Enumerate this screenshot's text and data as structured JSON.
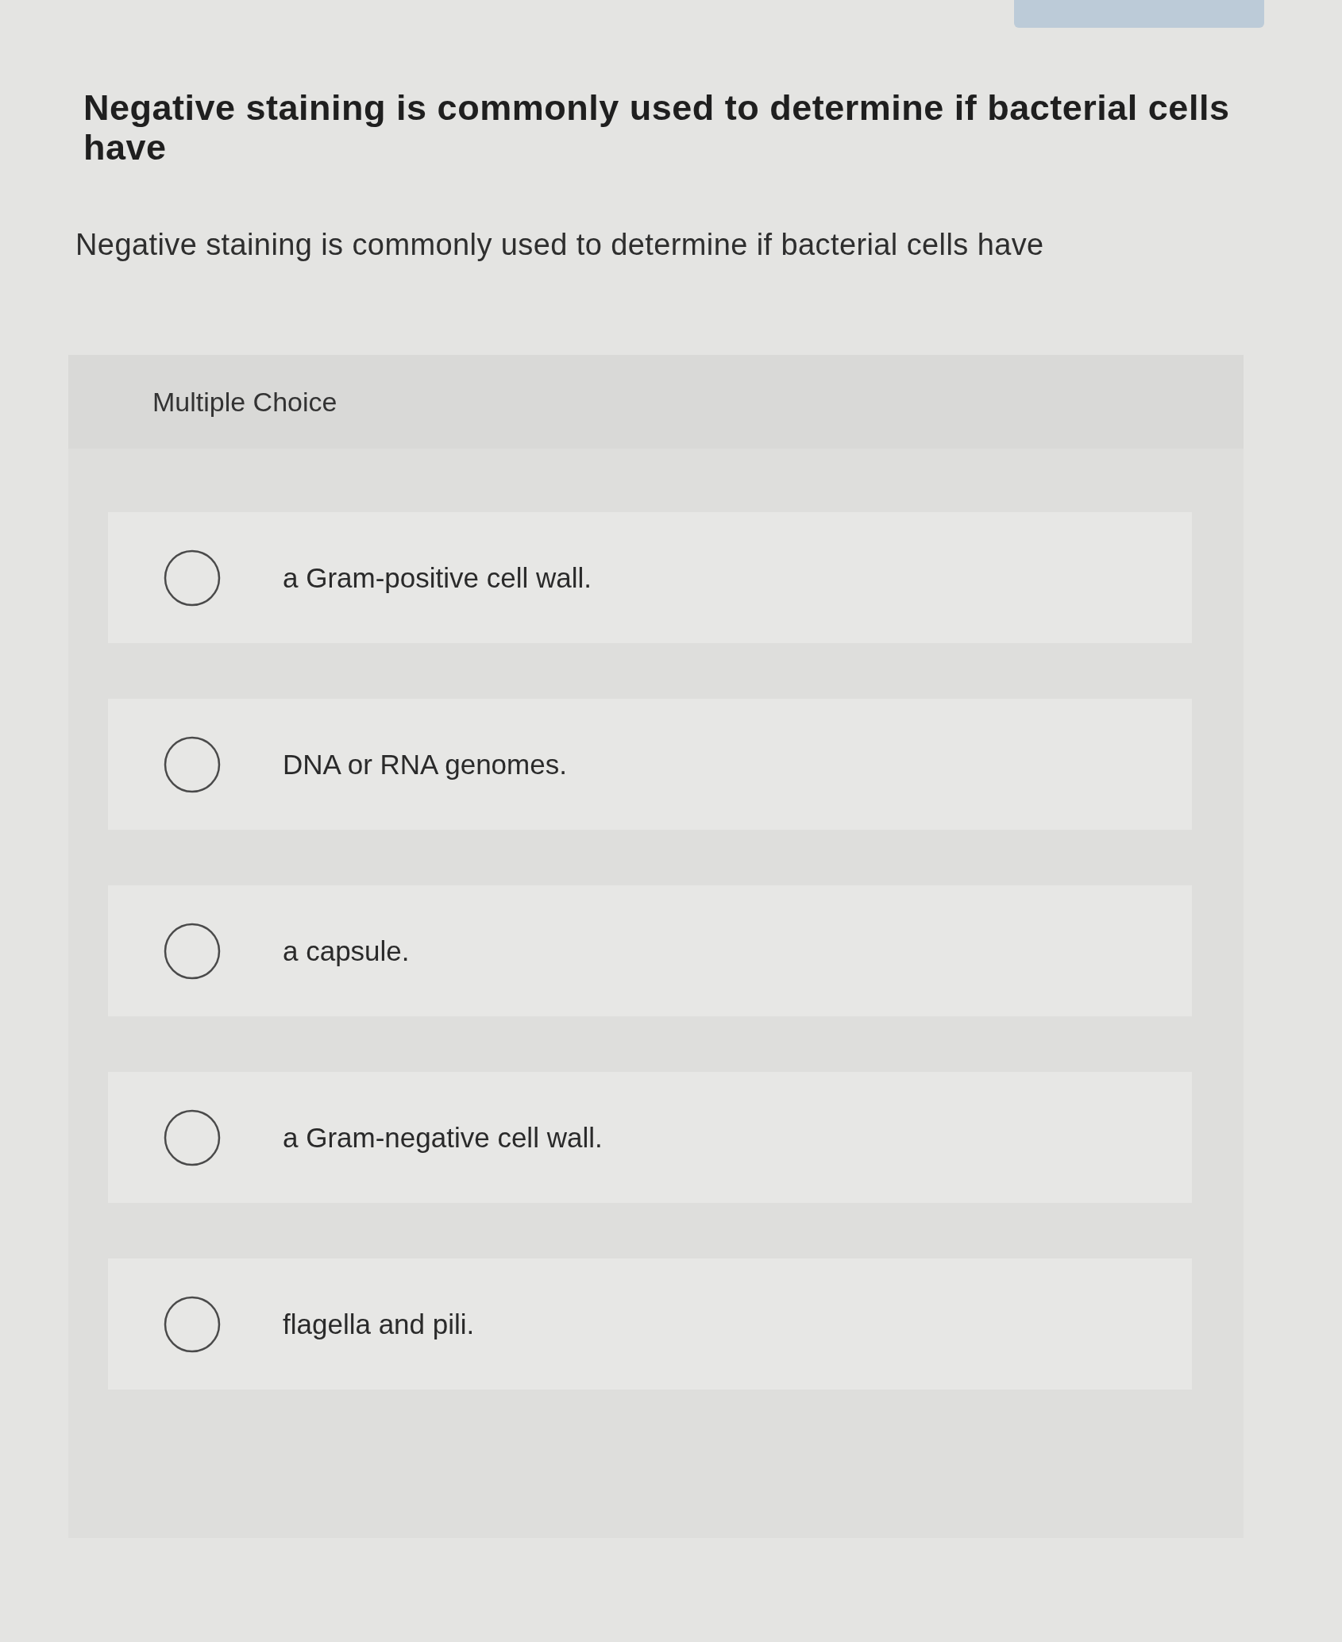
{
  "question": {
    "title": "Negative staining is commonly used to determine if bacterial cells have",
    "prompt": "Negative staining is commonly used to determine if bacterial cells have"
  },
  "answer_panel": {
    "heading": "Multiple Choice",
    "options": [
      {
        "label": "a Gram-positive cell wall.",
        "selected": false
      },
      {
        "label": "DNA or RNA genomes.",
        "selected": false
      },
      {
        "label": "a capsule.",
        "selected": false
      },
      {
        "label": "a Gram-negative cell wall.",
        "selected": false
      },
      {
        "label": "flagella and pili.",
        "selected": false
      }
    ]
  }
}
